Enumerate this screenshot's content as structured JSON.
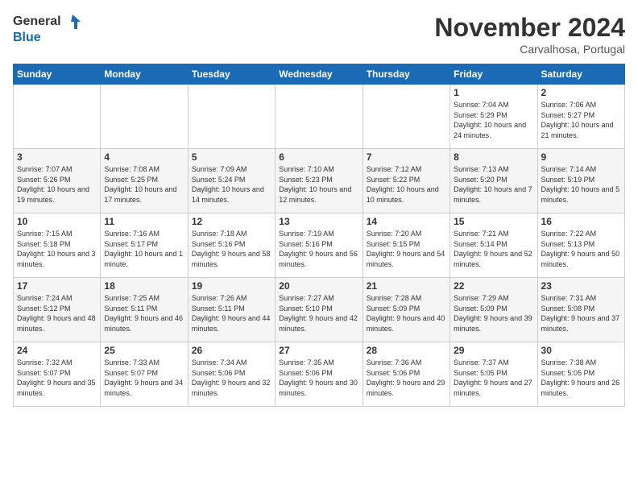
{
  "logo": {
    "line1": "General",
    "line2": "Blue"
  },
  "title": "November 2024",
  "location": "Carvalhosa, Portugal",
  "weekdays": [
    "Sunday",
    "Monday",
    "Tuesday",
    "Wednesday",
    "Thursday",
    "Friday",
    "Saturday"
  ],
  "weeks": [
    [
      {
        "day": "",
        "content": ""
      },
      {
        "day": "",
        "content": ""
      },
      {
        "day": "",
        "content": ""
      },
      {
        "day": "",
        "content": ""
      },
      {
        "day": "",
        "content": ""
      },
      {
        "day": "1",
        "content": "Sunrise: 7:04 AM\nSunset: 5:29 PM\nDaylight: 10 hours and 24 minutes."
      },
      {
        "day": "2",
        "content": "Sunrise: 7:06 AM\nSunset: 5:27 PM\nDaylight: 10 hours and 21 minutes."
      }
    ],
    [
      {
        "day": "3",
        "content": "Sunrise: 7:07 AM\nSunset: 5:26 PM\nDaylight: 10 hours and 19 minutes."
      },
      {
        "day": "4",
        "content": "Sunrise: 7:08 AM\nSunset: 5:25 PM\nDaylight: 10 hours and 17 minutes."
      },
      {
        "day": "5",
        "content": "Sunrise: 7:09 AM\nSunset: 5:24 PM\nDaylight: 10 hours and 14 minutes."
      },
      {
        "day": "6",
        "content": "Sunrise: 7:10 AM\nSunset: 5:23 PM\nDaylight: 10 hours and 12 minutes."
      },
      {
        "day": "7",
        "content": "Sunrise: 7:12 AM\nSunset: 5:22 PM\nDaylight: 10 hours and 10 minutes."
      },
      {
        "day": "8",
        "content": "Sunrise: 7:13 AM\nSunset: 5:20 PM\nDaylight: 10 hours and 7 minutes."
      },
      {
        "day": "9",
        "content": "Sunrise: 7:14 AM\nSunset: 5:19 PM\nDaylight: 10 hours and 5 minutes."
      }
    ],
    [
      {
        "day": "10",
        "content": "Sunrise: 7:15 AM\nSunset: 5:18 PM\nDaylight: 10 hours and 3 minutes."
      },
      {
        "day": "11",
        "content": "Sunrise: 7:16 AM\nSunset: 5:17 PM\nDaylight: 10 hours and 1 minute."
      },
      {
        "day": "12",
        "content": "Sunrise: 7:18 AM\nSunset: 5:16 PM\nDaylight: 9 hours and 58 minutes."
      },
      {
        "day": "13",
        "content": "Sunrise: 7:19 AM\nSunset: 5:16 PM\nDaylight: 9 hours and 56 minutes."
      },
      {
        "day": "14",
        "content": "Sunrise: 7:20 AM\nSunset: 5:15 PM\nDaylight: 9 hours and 54 minutes."
      },
      {
        "day": "15",
        "content": "Sunrise: 7:21 AM\nSunset: 5:14 PM\nDaylight: 9 hours and 52 minutes."
      },
      {
        "day": "16",
        "content": "Sunrise: 7:22 AM\nSunset: 5:13 PM\nDaylight: 9 hours and 50 minutes."
      }
    ],
    [
      {
        "day": "17",
        "content": "Sunrise: 7:24 AM\nSunset: 5:12 PM\nDaylight: 9 hours and 48 minutes."
      },
      {
        "day": "18",
        "content": "Sunrise: 7:25 AM\nSunset: 5:11 PM\nDaylight: 9 hours and 46 minutes."
      },
      {
        "day": "19",
        "content": "Sunrise: 7:26 AM\nSunset: 5:11 PM\nDaylight: 9 hours and 44 minutes."
      },
      {
        "day": "20",
        "content": "Sunrise: 7:27 AM\nSunset: 5:10 PM\nDaylight: 9 hours and 42 minutes."
      },
      {
        "day": "21",
        "content": "Sunrise: 7:28 AM\nSunset: 5:09 PM\nDaylight: 9 hours and 40 minutes."
      },
      {
        "day": "22",
        "content": "Sunrise: 7:29 AM\nSunset: 5:09 PM\nDaylight: 9 hours and 39 minutes."
      },
      {
        "day": "23",
        "content": "Sunrise: 7:31 AM\nSunset: 5:08 PM\nDaylight: 9 hours and 37 minutes."
      }
    ],
    [
      {
        "day": "24",
        "content": "Sunrise: 7:32 AM\nSunset: 5:07 PM\nDaylight: 9 hours and 35 minutes."
      },
      {
        "day": "25",
        "content": "Sunrise: 7:33 AM\nSunset: 5:07 PM\nDaylight: 9 hours and 34 minutes."
      },
      {
        "day": "26",
        "content": "Sunrise: 7:34 AM\nSunset: 5:06 PM\nDaylight: 9 hours and 32 minutes."
      },
      {
        "day": "27",
        "content": "Sunrise: 7:35 AM\nSunset: 5:06 PM\nDaylight: 9 hours and 30 minutes."
      },
      {
        "day": "28",
        "content": "Sunrise: 7:36 AM\nSunset: 5:06 PM\nDaylight: 9 hours and 29 minutes."
      },
      {
        "day": "29",
        "content": "Sunrise: 7:37 AM\nSunset: 5:05 PM\nDaylight: 9 hours and 27 minutes."
      },
      {
        "day": "30",
        "content": "Sunrise: 7:38 AM\nSunset: 5:05 PM\nDaylight: 9 hours and 26 minutes."
      }
    ]
  ]
}
